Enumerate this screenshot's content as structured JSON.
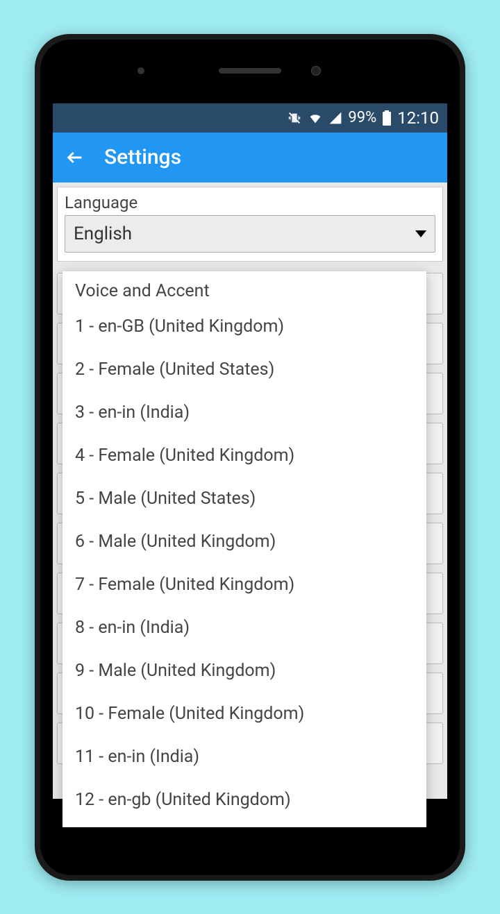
{
  "status": {
    "battery": "99%",
    "time": "12:10"
  },
  "appbar": {
    "title": "Settings"
  },
  "language": {
    "label": "Language",
    "value": "English"
  },
  "voice": {
    "header": "Voice and Accent",
    "items": [
      "1 - en-GB (United Kingdom)",
      "2 - Female (United States)",
      "3 - en-in (India)",
      "4 - Female (United Kingdom)",
      "5 - Male (United States)",
      "6 - Male (United Kingdom)",
      "7 - Female (United Kingdom)",
      "8 - en-in (India)",
      "9 - Male (United Kingdom)",
      "10 - Female (United Kingdom)",
      "11 - en-in (India)",
      "12 - en-gb (United Kingdom)"
    ]
  }
}
